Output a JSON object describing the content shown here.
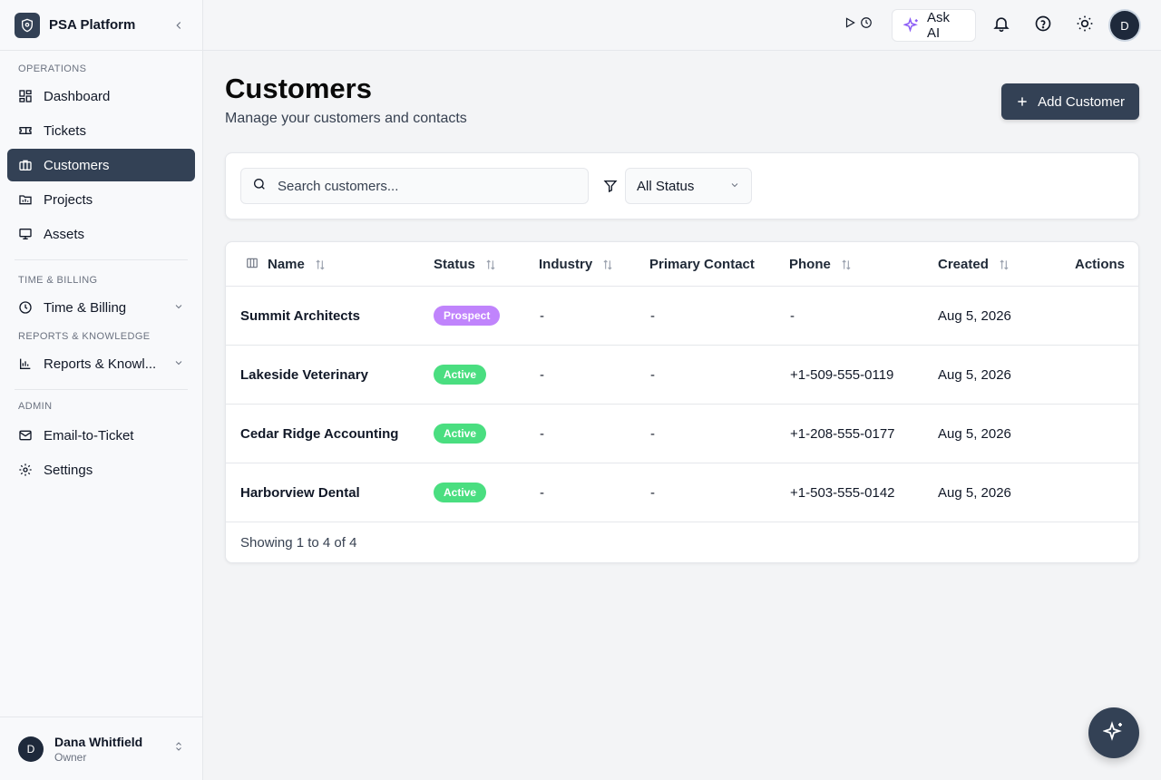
{
  "brand": {
    "name": "PSA Platform"
  },
  "sidebar": {
    "sections": {
      "operations": "OPERATIONS",
      "time_billing": "TIME & BILLING",
      "reports": "REPORTS & KNOWLEDGE",
      "admin": "ADMIN"
    },
    "items": {
      "dashboard": "Dashboard",
      "tickets": "Tickets",
      "customers": "Customers",
      "projects": "Projects",
      "assets": "Assets",
      "time_billing": "Time & Billing",
      "reports": "Reports & Knowl...",
      "email_to_ticket": "Email-to-Ticket",
      "settings": "Settings"
    },
    "active": "customers"
  },
  "user": {
    "initial": "D",
    "name": "Dana Whitfield",
    "role": "Owner"
  },
  "topbar": {
    "ask_ai_label": "Ask AI",
    "avatar_initial": "D"
  },
  "page": {
    "title": "Customers",
    "subtitle": "Manage your customers and contacts",
    "add_button": "Add Customer"
  },
  "filters": {
    "search_placeholder": "Search customers...",
    "search_value": "",
    "status_selected": "All Status"
  },
  "table": {
    "columns": {
      "name": "Name",
      "status": "Status",
      "industry": "Industry",
      "primary_contact": "Primary Contact",
      "phone": "Phone",
      "created": "Created",
      "actions": "Actions"
    },
    "rows": [
      {
        "name": "Summit Architects",
        "status": "Prospect",
        "industry": "-",
        "contact": "-",
        "phone": "-",
        "created": "Aug 5, 2026"
      },
      {
        "name": "Lakeside Veterinary",
        "status": "Active",
        "industry": "-",
        "contact": "-",
        "phone": "+1-509-555-0119",
        "created": "Aug 5, 2026"
      },
      {
        "name": "Cedar Ridge Accounting",
        "status": "Active",
        "industry": "-",
        "contact": "-",
        "phone": "+1-208-555-0177",
        "created": "Aug 5, 2026"
      },
      {
        "name": "Harborview Dental",
        "status": "Active",
        "industry": "-",
        "contact": "-",
        "phone": "+1-503-555-0142",
        "created": "Aug 5, 2026"
      }
    ],
    "footer": "Showing 1 to 4 of 4"
  },
  "colors": {
    "accent": "#334155",
    "prospect": "#c084fc",
    "active": "#4ade80",
    "ai_icon": "#8b5cf6"
  }
}
